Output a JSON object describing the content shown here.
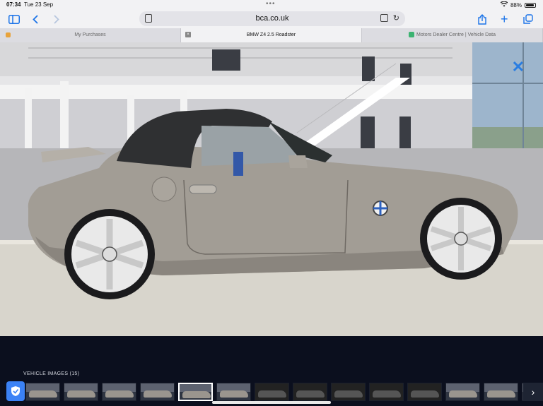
{
  "status": {
    "time": "07:34",
    "date": "Tue 23 Sep",
    "battery": "88%",
    "battery_level": 0.88
  },
  "toolbar": {
    "url": "bca.co.uk"
  },
  "tabs": [
    {
      "label": "My Purchases",
      "active": false
    },
    {
      "label": "BMW Z4 2.5 Roadster",
      "active": true
    },
    {
      "label": "Motors Dealer Centre | Vehicle Data",
      "active": false
    }
  ],
  "gallery": {
    "title": "VEHICLE IMAGES (15)",
    "thumbnails": [
      {
        "kind": "exterior"
      },
      {
        "kind": "exterior"
      },
      {
        "kind": "exterior"
      },
      {
        "kind": "exterior"
      },
      {
        "kind": "exterior",
        "active": true
      },
      {
        "kind": "exterior"
      },
      {
        "kind": "interior"
      },
      {
        "kind": "interior"
      },
      {
        "kind": "interior"
      },
      {
        "kind": "interior"
      },
      {
        "kind": "interior"
      },
      {
        "kind": "exterior"
      },
      {
        "kind": "exterior"
      },
      {
        "kind": "exterior"
      }
    ]
  },
  "colors": {
    "accent": "#1a73e8",
    "car_body": "#a29d95",
    "gallery_bg": "#0b0f1e"
  }
}
